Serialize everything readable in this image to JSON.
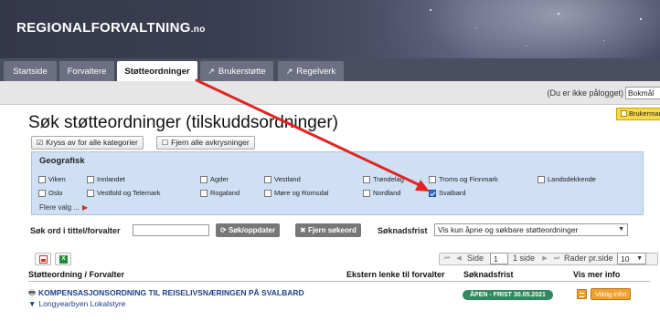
{
  "brand": {
    "name": "REGIONALFORVALTNING",
    "suffix": ".no"
  },
  "tabs": [
    {
      "label": "Startside",
      "ext": ""
    },
    {
      "label": "Forvaltere",
      "ext": ""
    },
    {
      "label": "Støtteordninger",
      "ext": "",
      "active": true
    },
    {
      "label": "Brukerstøtte",
      "ext": "↗"
    },
    {
      "label": "Regelverk",
      "ext": "↗"
    }
  ],
  "statusbar": {
    "login_text": "(Du er ikke pålogget)",
    "language": "Bokmål"
  },
  "help_button": "Brukermanual",
  "page_title": "Søk støtteordninger (tilskuddsordninger)",
  "buttons": {
    "check_all": "Kryss av for alle kategorier",
    "uncheck_all": "Fjern alle avkrysninger"
  },
  "geo": {
    "label": "Geografisk",
    "options": [
      {
        "label": "Viken",
        "checked": false
      },
      {
        "label": "Innlandet",
        "checked": false
      },
      {
        "label": "Agder",
        "checked": false
      },
      {
        "label": "Vestland",
        "checked": false
      },
      {
        "label": "Trøndelag",
        "checked": false
      },
      {
        "label": "Troms og Finnmark",
        "checked": false
      },
      {
        "label": "Landsdekkende",
        "checked": false
      },
      {
        "label": "Oslo",
        "checked": false
      },
      {
        "label": "Vestfold og Telemark",
        "checked": false
      },
      {
        "label": "Rogaland",
        "checked": false
      },
      {
        "label": "Møre og Romsdal",
        "checked": false
      },
      {
        "label": "Nordland",
        "checked": false
      },
      {
        "label": "Svalbard",
        "checked": true
      }
    ],
    "more": "Flere valg ..."
  },
  "search": {
    "label": "Søk ord i tittel/forvalter",
    "value": "",
    "search_button": "Søk/oppdater",
    "clear_button": "Fjern søkeord",
    "deadline_label": "Søknadsfrist",
    "deadline_value": "Vis kun åpne og søkbare støtteordninger"
  },
  "pager": {
    "page_label": "Side",
    "page_value": "1",
    "page_count": "1 side",
    "rows_label": "Rader pr.side",
    "rows_value": "10"
  },
  "table": {
    "headers": [
      "Støtteordning / Forvalter",
      "Ekstern lenke til forvalter",
      "Søknadsfrist",
      "Vis mer info"
    ],
    "rows": [
      {
        "title": "KOMPENSASJONSORDNING TIL REISELIVSNÆRINGEN PÅ SVALBARD",
        "manager": "Longyearbyen Lokalstyre",
        "deadline": "ÅPEN - FRIST 30.05.2021",
        "info_label": "Viktig info!"
      }
    ]
  },
  "colors": {
    "banner": "#3b3e52",
    "tabbar": "#4b4e60",
    "geo_bg": "#cfe0f4",
    "badge": "#2e8a5e",
    "annotation_arrow": "#e02424",
    "info": "#f0a030"
  }
}
